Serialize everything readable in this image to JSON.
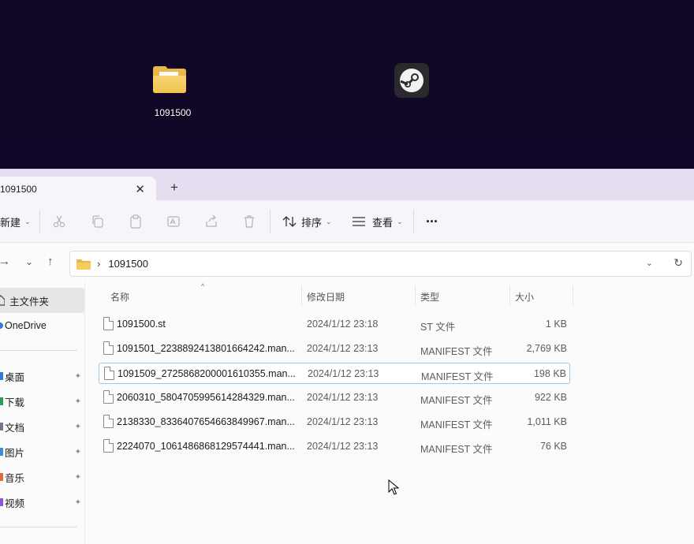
{
  "desktop": {
    "folder_label": "1091500"
  },
  "tab": {
    "title": "1091500",
    "close_glyph": "✕",
    "add_glyph": "+"
  },
  "toolbar": {
    "new_label": "新建",
    "sort_label": "排序",
    "view_label": "查看",
    "more_glyph": "···",
    "caret": "⌄",
    "icons": [
      "cut-icon",
      "copy-icon",
      "paste-icon",
      "rename-icon",
      "share-icon",
      "delete-icon"
    ]
  },
  "navigation": {
    "forward_glyph": "→",
    "recent_glyph": "⌄",
    "up_glyph": "↑",
    "breadcrumb_sep": "›",
    "path": "1091500",
    "dropdown_glyph": "⌄",
    "refresh_glyph": "↻"
  },
  "sidebar": {
    "items": [
      {
        "label": "主文件夹"
      },
      {
        "label": "OneDrive"
      },
      {
        "label": "桌面"
      },
      {
        "label": "下载"
      },
      {
        "label": "文档"
      },
      {
        "label": "图片"
      },
      {
        "label": "音乐"
      },
      {
        "label": "视频"
      }
    ],
    "pin_glyph": "📌"
  },
  "columns": {
    "name": "名称",
    "date": "修改日期",
    "type": "类型",
    "size": "大小",
    "sort_glyph": "^"
  },
  "files": [
    {
      "name": "1091500.st",
      "date": "2024/1/12 23:18",
      "type": "ST 文件",
      "size": "1 KB"
    },
    {
      "name": "1091501_2238892413801664242.man...",
      "date": "2024/1/12 23:13",
      "type": "MANIFEST 文件",
      "size": "2,769 KB"
    },
    {
      "name": "1091509_2725868200001610355.man...",
      "date": "2024/1/12 23:13",
      "type": "MANIFEST 文件",
      "size": "198 KB"
    },
    {
      "name": "2060310_5804705995614284329.man...",
      "date": "2024/1/12 23:13",
      "type": "MANIFEST 文件",
      "size": "922 KB"
    },
    {
      "name": "2138330_8336407654663849967.man...",
      "date": "2024/1/12 23:13",
      "type": "MANIFEST 文件",
      "size": "1,011 KB"
    },
    {
      "name": "2224070_1061486868129574441.man...",
      "date": "2024/1/12 23:13",
      "type": "MANIFEST 文件",
      "size": "76 KB"
    }
  ],
  "selected_row_index": 2,
  "colors": {
    "accent": "#0067c0",
    "folder": "#f0c452",
    "desktop": "#120826"
  }
}
